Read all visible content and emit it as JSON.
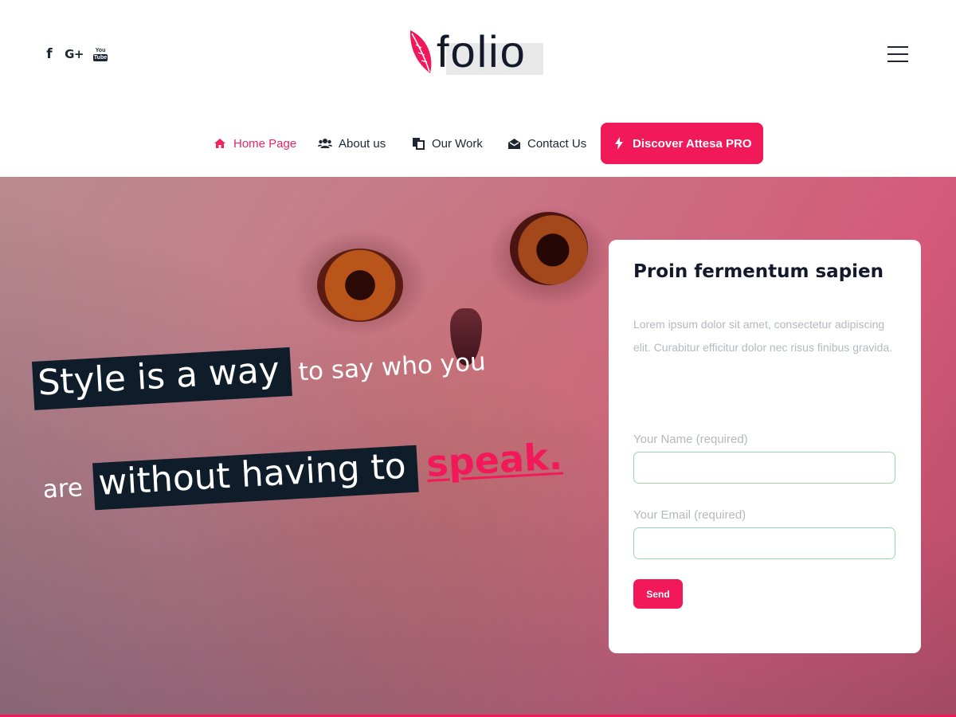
{
  "header": {
    "social": [
      {
        "icon": "facebook-icon",
        "glyph": "f"
      },
      {
        "icon": "google-plus-icon",
        "glyph": "G+"
      },
      {
        "icon": "youtube-icon",
        "glyph_top": "You",
        "glyph_bottom": "Tube"
      }
    ],
    "logo_text": "folio",
    "menu_icon": "hamburger-menu-icon"
  },
  "nav": {
    "items": [
      {
        "label": "Home Page",
        "icon": "home-icon",
        "active": true
      },
      {
        "label": "About us",
        "icon": "users-icon",
        "active": false
      },
      {
        "label": "Our Work",
        "icon": "copy-icon",
        "active": false
      },
      {
        "label": "Contact Us",
        "icon": "envelope-open-icon",
        "active": false
      }
    ],
    "cta": {
      "label": "Discover Attesa PRO",
      "icon": "bolt-icon"
    }
  },
  "hero": {
    "line1_highlight": "Style is a way",
    "line1_rest": "to say who you",
    "line2_start": "are",
    "line2_highlight": "without having to",
    "line2_accent": "speak."
  },
  "form": {
    "title": "Proin fermentum sapien",
    "description": "Lorem ipsum dolor sit amet, consectetur adipiscing elit. Curabitur efficitur dolor nec risus finibus gravida.",
    "name_label": "Your Name (required)",
    "name_value": "",
    "email_label": "Your Email (required)",
    "email_value": "",
    "submit_label": "Send"
  },
  "colors": {
    "accent": "#f2195b",
    "dark": "#0f1d2a",
    "field_border": "#9dd8ab"
  }
}
